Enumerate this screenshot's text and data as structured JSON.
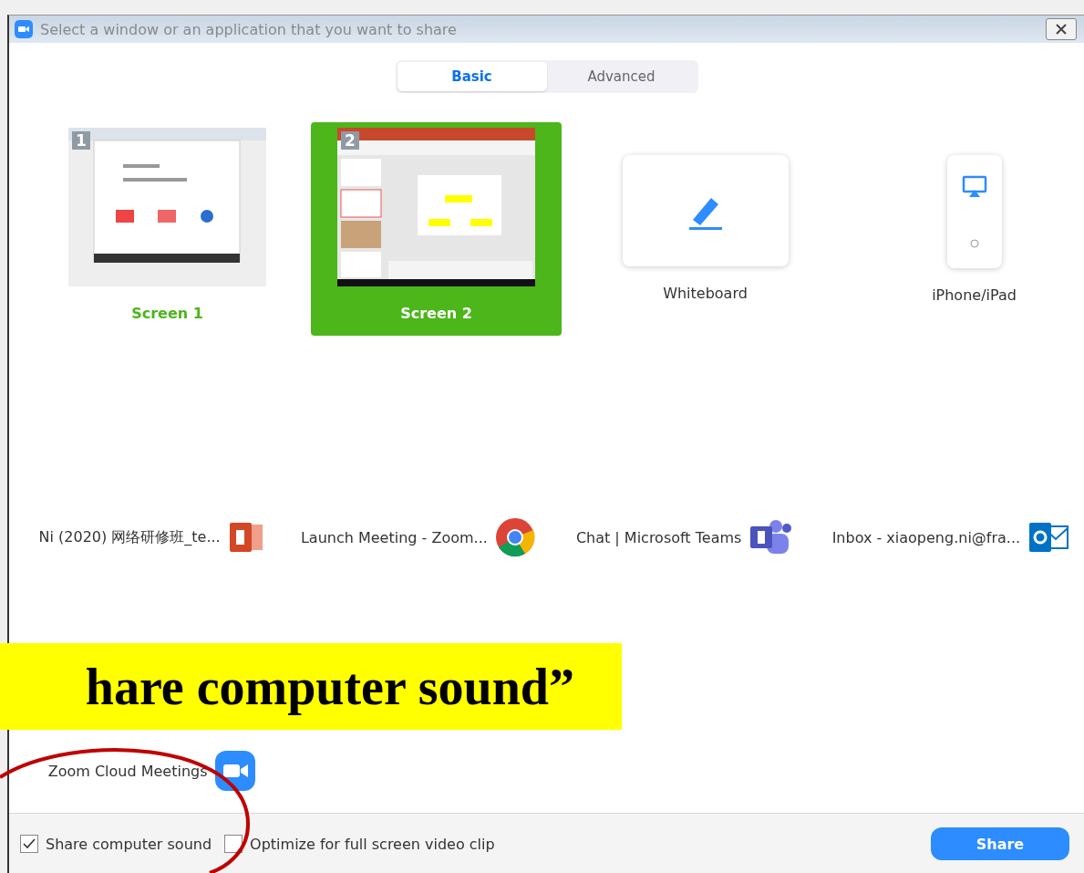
{
  "window": {
    "title": "Select a window or an application that you want to share"
  },
  "tabs": [
    {
      "label": "Basic",
      "selected": true
    },
    {
      "label": "Advanced",
      "selected": false
    }
  ],
  "screens": [
    {
      "kind": "screen",
      "number": "1",
      "label": "Screen 1",
      "selected": false
    },
    {
      "kind": "screen",
      "number": "2",
      "label": "Screen 2",
      "selected": true
    },
    {
      "kind": "whiteboard",
      "label": "Whiteboard",
      "selected": false
    },
    {
      "kind": "phone",
      "label": "iPhone/iPad",
      "selected": false
    }
  ],
  "applications": [
    {
      "kind": "powerpoint",
      "label": "Ni (2020) 网络研修班_te..."
    },
    {
      "kind": "chrome",
      "label": "Launch Meeting - Zoom..."
    },
    {
      "kind": "teams",
      "label": "Chat | Microsoft Teams"
    },
    {
      "kind": "outlook",
      "label": "Inbox - xiaopeng.ni@fra..."
    },
    {
      "kind": "zoom",
      "label": "Zoom Cloud Meetings"
    }
  ],
  "annotation": {
    "banner": "hare computer sound”"
  },
  "options": [
    {
      "label": "Share computer sound",
      "checked": true
    },
    {
      "label": "Optimize for full screen video clip",
      "checked": false
    }
  ],
  "share_button": "Share"
}
